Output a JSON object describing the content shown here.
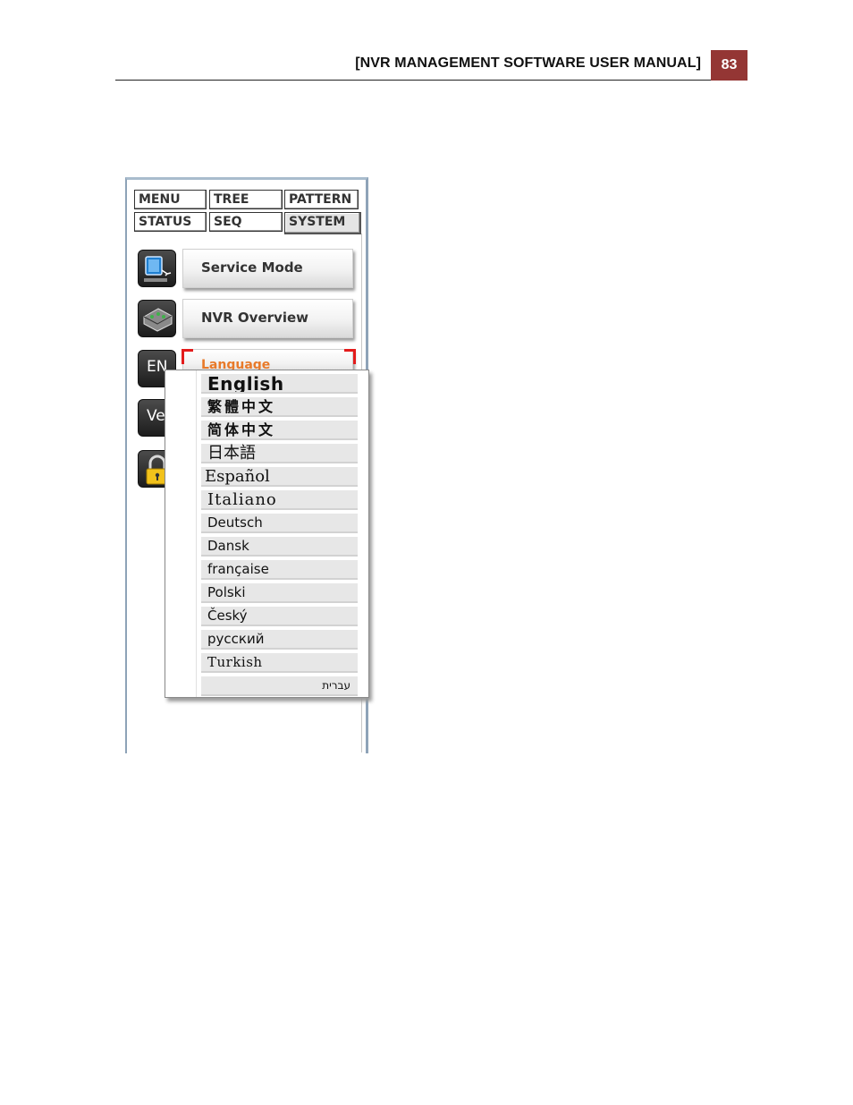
{
  "header": {
    "title": "[NVR MANAGEMENT SOFTWARE USER MANUAL]",
    "page_number": "83"
  },
  "colors": {
    "page_badge": "#943634",
    "selection_marker": "#e31b1b",
    "language_text": "#e87a2a"
  },
  "tabs": [
    {
      "label": "MENU"
    },
    {
      "label": "TREE"
    },
    {
      "label": "PATTERN"
    },
    {
      "label": "STATUS"
    },
    {
      "label": "SEQ"
    },
    {
      "label": "SYSTEM",
      "active": true
    }
  ],
  "menu": {
    "service_mode": "Service Mode",
    "nvr_overview": "NVR Overview",
    "language": "Language",
    "language_icon": "EN",
    "version_icon": "Ve"
  },
  "icons": [
    "monitor-icon",
    "nvr-device-icon",
    "language-en-icon",
    "version-icon",
    "lock-icon"
  ],
  "languages": [
    "English",
    "繁體中文",
    "简体中文",
    "日本語",
    "Español",
    "Italiano",
    "Deutsch",
    "Dansk",
    "française",
    "Polski",
    "Český",
    "русский",
    "Turkish",
    "עברית"
  ]
}
